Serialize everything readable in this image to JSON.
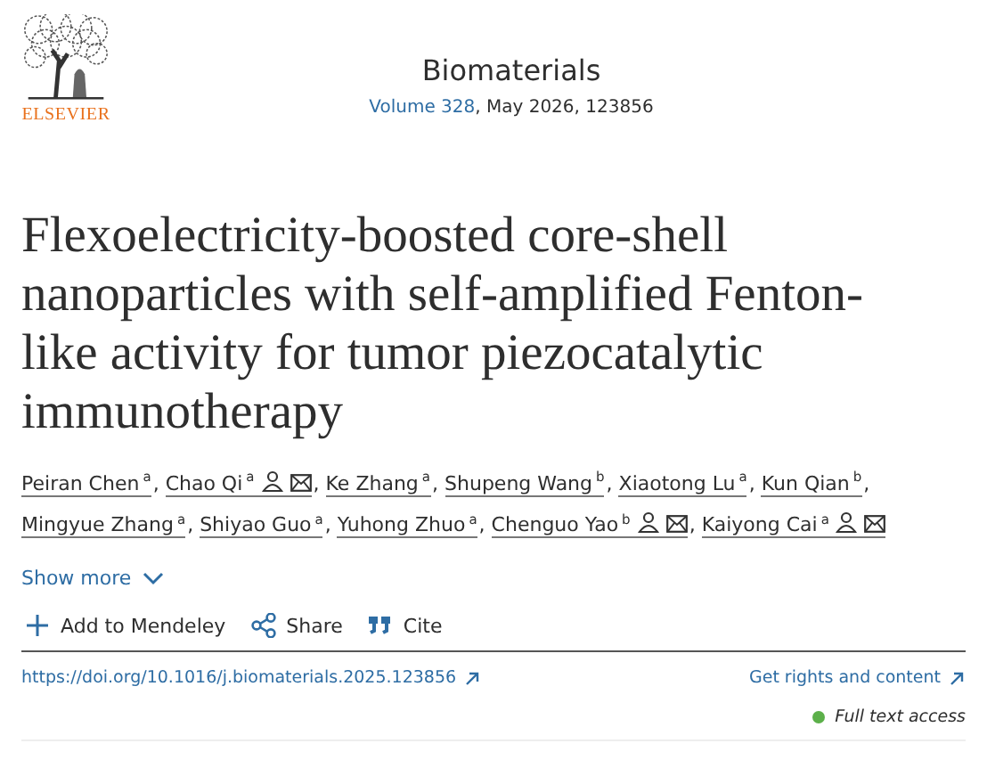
{
  "publisher": {
    "name": "ELSEVIER"
  },
  "journal": {
    "title": "Biomaterials",
    "volume_link": "Volume 328",
    "issue_info": ", May 2026, 123856"
  },
  "article": {
    "title": "Flexoelectricity-boosted core-shell nanoparticles with self-amplified Fenton-like activity for tumor piezocatalytic immunotherapy"
  },
  "authors": [
    {
      "name": "Peiran Chen",
      "affiliation": "a",
      "corresponding": false,
      "separator": ","
    },
    {
      "name": "Chao Qi",
      "affiliation": "a",
      "corresponding": true,
      "separator": ","
    },
    {
      "name": "Ke Zhang",
      "affiliation": "a",
      "corresponding": false,
      "separator": ","
    },
    {
      "name": "Shupeng Wang",
      "affiliation": "b",
      "corresponding": false,
      "separator": ","
    },
    {
      "name": "Xiaotong Lu",
      "affiliation": "a",
      "corresponding": false,
      "separator": ","
    },
    {
      "name": "Kun Qian",
      "affiliation": "b",
      "corresponding": false,
      "separator": ","
    },
    {
      "name": "Mingyue Zhang",
      "affiliation": "a",
      "corresponding": false,
      "separator": ","
    },
    {
      "name": "Shiyao Guo",
      "affiliation": "a",
      "corresponding": false,
      "separator": ","
    },
    {
      "name": "Yuhong Zhuo",
      "affiliation": "a",
      "corresponding": false,
      "separator": ","
    },
    {
      "name": "Chenguo Yao",
      "affiliation": "b",
      "corresponding": true,
      "separator": ","
    },
    {
      "name": "Kaiyong Cai",
      "affiliation": "a",
      "corresponding": true
    }
  ],
  "show_more": "Show more",
  "actions": [
    {
      "kind": "add",
      "label": "Add to Mendeley"
    },
    {
      "kind": "share",
      "label": "Share"
    },
    {
      "kind": "cite",
      "label": "Cite"
    }
  ],
  "doi_link": "https://doi.org/10.1016/j.biomaterials.2025.123856",
  "rights_link": "Get rights and content",
  "access": "Full text access"
}
